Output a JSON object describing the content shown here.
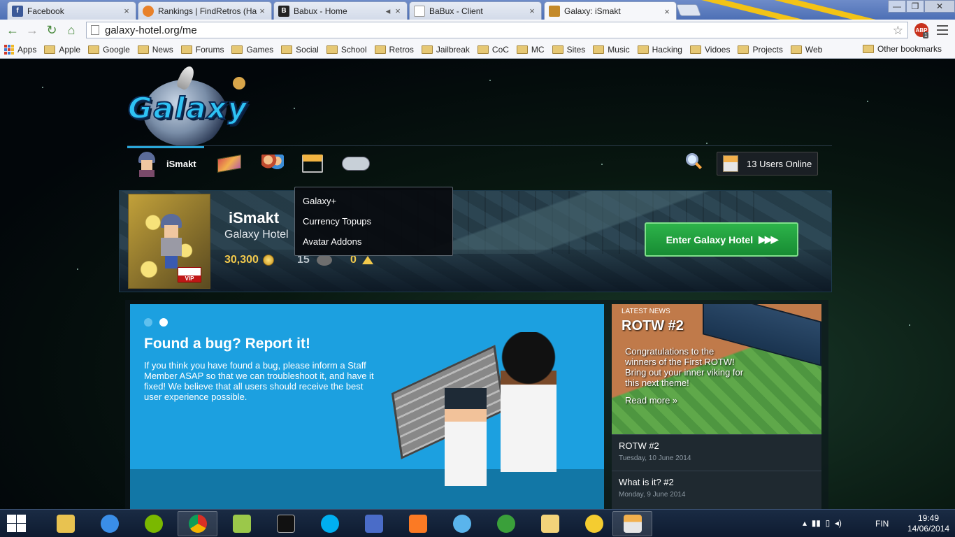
{
  "browser": {
    "tabs": [
      {
        "label": "Facebook",
        "favicon": "facebook-icon",
        "color": "#3b5998"
      },
      {
        "label": "Rankings | FindRetros (Ha",
        "favicon": "fire-icon",
        "color": "#e8812a"
      },
      {
        "label": "Babux - Home",
        "favicon": "b-icon",
        "color": "#222222"
      },
      {
        "label": "BaBux - Client",
        "favicon": "page-icon",
        "color": "#ffffff"
      },
      {
        "label": "Galaxy: iSmakt",
        "favicon": "hotel-icon",
        "color": "#c48a2a"
      }
    ],
    "address": "galaxy-hotel.org/me",
    "abp_count": "1",
    "bookmarks": [
      "Apps",
      "Apple",
      "Google",
      "News",
      "Forums",
      "Games",
      "Social",
      "School",
      "Retros",
      "Jailbreak",
      "CoC",
      "MC",
      "Sites",
      "Music",
      "Hacking",
      "Vidoes",
      "Projects",
      "Web"
    ],
    "other_bookmarks": "Other bookmarks"
  },
  "site": {
    "logo_text": "Galaxy",
    "nav": {
      "username": "iSmakt",
      "users_online": "13 Users Online"
    },
    "dropdown": [
      "Galaxy+",
      "Currency Topups",
      "Avatar Addons"
    ],
    "profile": {
      "name": "iSmakt",
      "hotel": "Galaxy Hotel",
      "credits": "30,300",
      "duckets": "15",
      "diamonds": "0",
      "vip_label": "VIP",
      "enter_button": "Enter Galaxy Hotel"
    },
    "slider": {
      "title": "Found a bug? Report it!",
      "text": "If you think you have found a bug, please inform a Staff Member ASAP so that we can troubleshoot it, and have it fixed! We believe that all users should receive the best user experience possible."
    },
    "news": {
      "badge": "LATEST NEWS",
      "featured_title": "ROTW #2",
      "featured_desc": "Congratulations to the winners of the First ROTW! Bring out your inner viking for this next theme!",
      "read_more": "Read more »",
      "items": [
        {
          "title": "ROTW #2",
          "date": "Tuesday, 10 June 2014"
        },
        {
          "title": "What is it? #2",
          "date": "Monday, 9 June 2014"
        }
      ]
    }
  },
  "taskbar": {
    "apps": [
      "file-explorer-icon",
      "utility-icon",
      "spotify-icon",
      "chrome-icon",
      "notepad-icon",
      "cmd-icon",
      "skype-icon",
      "paint-icon",
      "xampp-icon",
      "itunes-icon",
      "game-icon",
      "habbo-icon",
      "banana-icon",
      "hotel-icon"
    ],
    "language": "FIN",
    "time": "19:49",
    "date": "14/06/2014"
  }
}
